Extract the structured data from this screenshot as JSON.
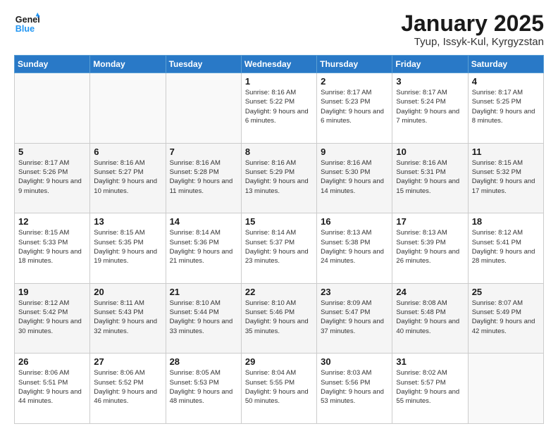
{
  "logo": {
    "line1": "General",
    "line2": "Blue"
  },
  "title": "January 2025",
  "subtitle": "Tyup, Issyk-Kul, Kyrgyzstan",
  "weekdays": [
    "Sunday",
    "Monday",
    "Tuesday",
    "Wednesday",
    "Thursday",
    "Friday",
    "Saturday"
  ],
  "weeks": [
    [
      {
        "day": "",
        "sunrise": "",
        "sunset": "",
        "daylight": ""
      },
      {
        "day": "",
        "sunrise": "",
        "sunset": "",
        "daylight": ""
      },
      {
        "day": "",
        "sunrise": "",
        "sunset": "",
        "daylight": ""
      },
      {
        "day": "1",
        "sunrise": "Sunrise: 8:16 AM",
        "sunset": "Sunset: 5:22 PM",
        "daylight": "Daylight: 9 hours and 6 minutes."
      },
      {
        "day": "2",
        "sunrise": "Sunrise: 8:17 AM",
        "sunset": "Sunset: 5:23 PM",
        "daylight": "Daylight: 9 hours and 6 minutes."
      },
      {
        "day": "3",
        "sunrise": "Sunrise: 8:17 AM",
        "sunset": "Sunset: 5:24 PM",
        "daylight": "Daylight: 9 hours and 7 minutes."
      },
      {
        "day": "4",
        "sunrise": "Sunrise: 8:17 AM",
        "sunset": "Sunset: 5:25 PM",
        "daylight": "Daylight: 9 hours and 8 minutes."
      }
    ],
    [
      {
        "day": "5",
        "sunrise": "Sunrise: 8:17 AM",
        "sunset": "Sunset: 5:26 PM",
        "daylight": "Daylight: 9 hours and 9 minutes."
      },
      {
        "day": "6",
        "sunrise": "Sunrise: 8:16 AM",
        "sunset": "Sunset: 5:27 PM",
        "daylight": "Daylight: 9 hours and 10 minutes."
      },
      {
        "day": "7",
        "sunrise": "Sunrise: 8:16 AM",
        "sunset": "Sunset: 5:28 PM",
        "daylight": "Daylight: 9 hours and 11 minutes."
      },
      {
        "day": "8",
        "sunrise": "Sunrise: 8:16 AM",
        "sunset": "Sunset: 5:29 PM",
        "daylight": "Daylight: 9 hours and 13 minutes."
      },
      {
        "day": "9",
        "sunrise": "Sunrise: 8:16 AM",
        "sunset": "Sunset: 5:30 PM",
        "daylight": "Daylight: 9 hours and 14 minutes."
      },
      {
        "day": "10",
        "sunrise": "Sunrise: 8:16 AM",
        "sunset": "Sunset: 5:31 PM",
        "daylight": "Daylight: 9 hours and 15 minutes."
      },
      {
        "day": "11",
        "sunrise": "Sunrise: 8:15 AM",
        "sunset": "Sunset: 5:32 PM",
        "daylight": "Daylight: 9 hours and 17 minutes."
      }
    ],
    [
      {
        "day": "12",
        "sunrise": "Sunrise: 8:15 AM",
        "sunset": "Sunset: 5:33 PM",
        "daylight": "Daylight: 9 hours and 18 minutes."
      },
      {
        "day": "13",
        "sunrise": "Sunrise: 8:15 AM",
        "sunset": "Sunset: 5:35 PM",
        "daylight": "Daylight: 9 hours and 19 minutes."
      },
      {
        "day": "14",
        "sunrise": "Sunrise: 8:14 AM",
        "sunset": "Sunset: 5:36 PM",
        "daylight": "Daylight: 9 hours and 21 minutes."
      },
      {
        "day": "15",
        "sunrise": "Sunrise: 8:14 AM",
        "sunset": "Sunset: 5:37 PM",
        "daylight": "Daylight: 9 hours and 23 minutes."
      },
      {
        "day": "16",
        "sunrise": "Sunrise: 8:13 AM",
        "sunset": "Sunset: 5:38 PM",
        "daylight": "Daylight: 9 hours and 24 minutes."
      },
      {
        "day": "17",
        "sunrise": "Sunrise: 8:13 AM",
        "sunset": "Sunset: 5:39 PM",
        "daylight": "Daylight: 9 hours and 26 minutes."
      },
      {
        "day": "18",
        "sunrise": "Sunrise: 8:12 AM",
        "sunset": "Sunset: 5:41 PM",
        "daylight": "Daylight: 9 hours and 28 minutes."
      }
    ],
    [
      {
        "day": "19",
        "sunrise": "Sunrise: 8:12 AM",
        "sunset": "Sunset: 5:42 PM",
        "daylight": "Daylight: 9 hours and 30 minutes."
      },
      {
        "day": "20",
        "sunrise": "Sunrise: 8:11 AM",
        "sunset": "Sunset: 5:43 PM",
        "daylight": "Daylight: 9 hours and 32 minutes."
      },
      {
        "day": "21",
        "sunrise": "Sunrise: 8:10 AM",
        "sunset": "Sunset: 5:44 PM",
        "daylight": "Daylight: 9 hours and 33 minutes."
      },
      {
        "day": "22",
        "sunrise": "Sunrise: 8:10 AM",
        "sunset": "Sunset: 5:46 PM",
        "daylight": "Daylight: 9 hours and 35 minutes."
      },
      {
        "day": "23",
        "sunrise": "Sunrise: 8:09 AM",
        "sunset": "Sunset: 5:47 PM",
        "daylight": "Daylight: 9 hours and 37 minutes."
      },
      {
        "day": "24",
        "sunrise": "Sunrise: 8:08 AM",
        "sunset": "Sunset: 5:48 PM",
        "daylight": "Daylight: 9 hours and 40 minutes."
      },
      {
        "day": "25",
        "sunrise": "Sunrise: 8:07 AM",
        "sunset": "Sunset: 5:49 PM",
        "daylight": "Daylight: 9 hours and 42 minutes."
      }
    ],
    [
      {
        "day": "26",
        "sunrise": "Sunrise: 8:06 AM",
        "sunset": "Sunset: 5:51 PM",
        "daylight": "Daylight: 9 hours and 44 minutes."
      },
      {
        "day": "27",
        "sunrise": "Sunrise: 8:06 AM",
        "sunset": "Sunset: 5:52 PM",
        "daylight": "Daylight: 9 hours and 46 minutes."
      },
      {
        "day": "28",
        "sunrise": "Sunrise: 8:05 AM",
        "sunset": "Sunset: 5:53 PM",
        "daylight": "Daylight: 9 hours and 48 minutes."
      },
      {
        "day": "29",
        "sunrise": "Sunrise: 8:04 AM",
        "sunset": "Sunset: 5:55 PM",
        "daylight": "Daylight: 9 hours and 50 minutes."
      },
      {
        "day": "30",
        "sunrise": "Sunrise: 8:03 AM",
        "sunset": "Sunset: 5:56 PM",
        "daylight": "Daylight: 9 hours and 53 minutes."
      },
      {
        "day": "31",
        "sunrise": "Sunrise: 8:02 AM",
        "sunset": "Sunset: 5:57 PM",
        "daylight": "Daylight: 9 hours and 55 minutes."
      },
      {
        "day": "",
        "sunrise": "",
        "sunset": "",
        "daylight": ""
      }
    ]
  ]
}
